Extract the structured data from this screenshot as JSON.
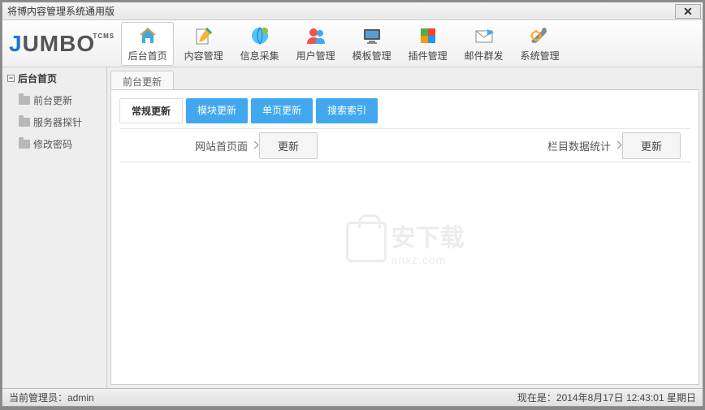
{
  "window": {
    "title": "将博内容管理系统通用版"
  },
  "logo": {
    "j": "J",
    "rest": "UMBO",
    "sup": "TCMS"
  },
  "toolbar": [
    {
      "id": "home",
      "label": "后台首页",
      "active": true
    },
    {
      "id": "content",
      "label": "内容管理"
    },
    {
      "id": "collect",
      "label": "信息采集"
    },
    {
      "id": "user",
      "label": "用户管理"
    },
    {
      "id": "template",
      "label": "模板管理"
    },
    {
      "id": "plugin",
      "label": "插件管理"
    },
    {
      "id": "mail",
      "label": "邮件群发"
    },
    {
      "id": "system",
      "label": "系统管理"
    }
  ],
  "sidebar": {
    "root": "后台首页",
    "items": [
      {
        "label": "前台更新"
      },
      {
        "label": "服务器探针"
      },
      {
        "label": "修改密码"
      }
    ]
  },
  "tab": {
    "label": "前台更新"
  },
  "subtabs": [
    {
      "label": "常规更新",
      "active": true
    },
    {
      "label": "模块更新"
    },
    {
      "label": "单页更新"
    },
    {
      "label": "搜索索引"
    }
  ],
  "form": {
    "field1": "网站首页面",
    "btn1": "更新",
    "field2": "栏目数据统计",
    "btn2": "更新"
  },
  "watermark": {
    "main": "安下载",
    "sub": "anxz.com"
  },
  "status": {
    "left": "当前管理员：admin",
    "right": "现在是：2014年8月17日 12:43:01  星期日"
  }
}
